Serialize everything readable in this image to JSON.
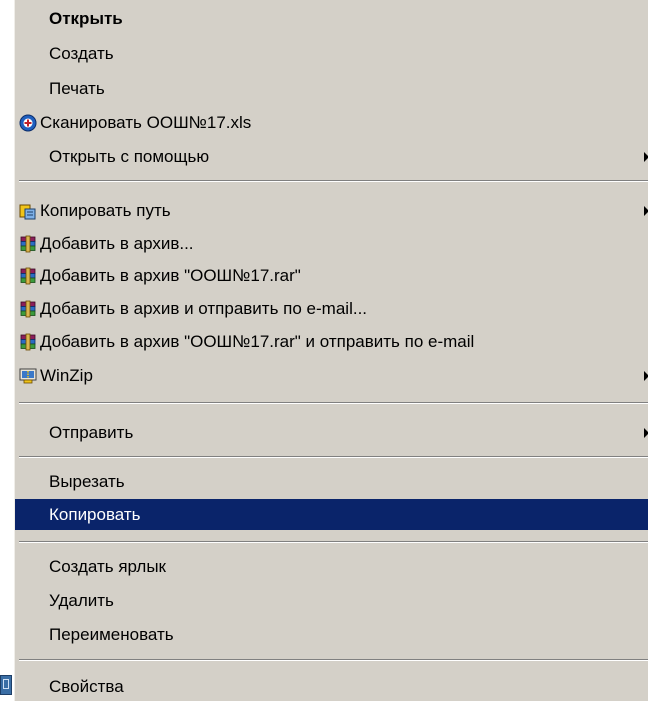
{
  "menu": {
    "items": [
      {
        "label": "Открыть"
      },
      {
        "label": "Создать"
      },
      {
        "label": "Печать"
      },
      {
        "label": "Сканировать ООШ№17.xls",
        "icon": "antivirus-scan-icon"
      },
      {
        "label": "Открыть с помощью",
        "submenu": true
      },
      {
        "label": "Копировать путь",
        "icon": "copy-path-icon",
        "submenu": true
      },
      {
        "label": "Добавить в архив...",
        "icon": "winrar-archive-icon"
      },
      {
        "label": "Добавить в архив \"ООШ№17.rar\"",
        "icon": "winrar-archive-icon"
      },
      {
        "label": "Добавить в архив и отправить по e-mail...",
        "icon": "winrar-archive-icon"
      },
      {
        "label": "Добавить в архив \"ООШ№17.rar\" и отправить по e-mail",
        "icon": "winrar-archive-icon"
      },
      {
        "label": "WinZip",
        "icon": "winzip-icon",
        "submenu": true
      },
      {
        "label": "Отправить",
        "submenu": true
      },
      {
        "label": "Вырезать"
      },
      {
        "label": "Копировать",
        "highlighted": true
      },
      {
        "label": "Создать ярлык"
      },
      {
        "label": "Удалить"
      },
      {
        "label": "Переименовать"
      },
      {
        "label": "Свойства"
      }
    ]
  },
  "colors": {
    "menu_background": "#d4d0c8",
    "highlight": "#0a246a",
    "highlight_text": "#ffffff",
    "text": "#000000"
  }
}
